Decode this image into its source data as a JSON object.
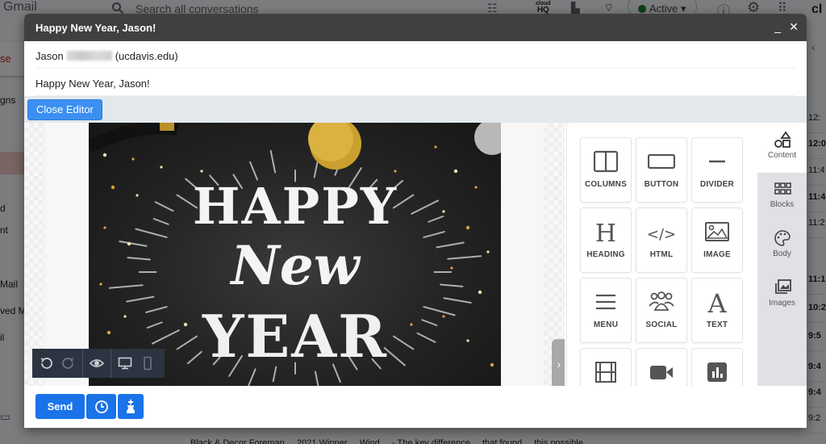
{
  "background": {
    "app_name": "Gmail",
    "search_placeholder": "Search all conversations",
    "status_label": "Active",
    "status_color": "#188038",
    "brand_partial": "cl",
    "cloudhq_logo_top": "cloud",
    "cloudhq_logo_bottom": "HQ",
    "compose_partial": "se",
    "sidebar_fragments": [
      "gns",
      "d",
      "nt",
      "Mail",
      "ved M",
      "il"
    ],
    "list_times": [
      {
        "text": "12:",
        "bold": false
      },
      {
        "text": "12:0",
        "bold": true
      },
      {
        "text": "11:4",
        "bold": false
      },
      {
        "text": "11:4",
        "bold": true
      },
      {
        "text": "11:2",
        "bold": false
      },
      {
        "text": "11:1",
        "bold": true
      },
      {
        "text": "10:2",
        "bold": true
      },
      {
        "text": "9:5",
        "bold": true
      },
      {
        "text": "9:4",
        "bold": true
      },
      {
        "text": "9:4",
        "bold": true
      },
      {
        "text": "9:2",
        "bold": false
      }
    ],
    "bottom_row_text": "Black & Decor Foreman ... 2021 Winner ... Wind ... - The key difference ... that found ... this possible"
  },
  "compose": {
    "title": "Happy New Year, Jason!",
    "to_name": "Jason",
    "to_domain": "(ucdavis.edu)",
    "subject": "Happy New Year, Jason!",
    "close_editor_label": "Close Editor",
    "hero_line1": "HAPPY",
    "hero_line2": "New",
    "hero_line3": "YEAR",
    "send_label": "Send",
    "accent_color": "#1a73e8"
  },
  "editor": {
    "content_tiles": [
      {
        "label": "COLUMNS",
        "icon": "columns-icon"
      },
      {
        "label": "BUTTON",
        "icon": "button-icon"
      },
      {
        "label": "DIVIDER",
        "icon": "divider-icon"
      },
      {
        "label": "HEADING",
        "icon": "heading-icon"
      },
      {
        "label": "HTML",
        "icon": "code-icon"
      },
      {
        "label": "IMAGE",
        "icon": "image-icon"
      },
      {
        "label": "MENU",
        "icon": "menu-icon"
      },
      {
        "label": "SOCIAL",
        "icon": "social-icon"
      },
      {
        "label": "TEXT",
        "icon": "text-icon"
      },
      {
        "label": "",
        "icon": "film-icon"
      },
      {
        "label": "",
        "icon": "video-icon"
      },
      {
        "label": "",
        "icon": "chart-icon"
      }
    ],
    "side_tabs": [
      {
        "label": "Content",
        "icon": "shapes-icon",
        "active": true
      },
      {
        "label": "Blocks",
        "icon": "grid-icon",
        "active": false
      },
      {
        "label": "Body",
        "icon": "palette-icon",
        "active": false
      },
      {
        "label": "Images",
        "icon": "images-icon",
        "active": false
      }
    ]
  }
}
